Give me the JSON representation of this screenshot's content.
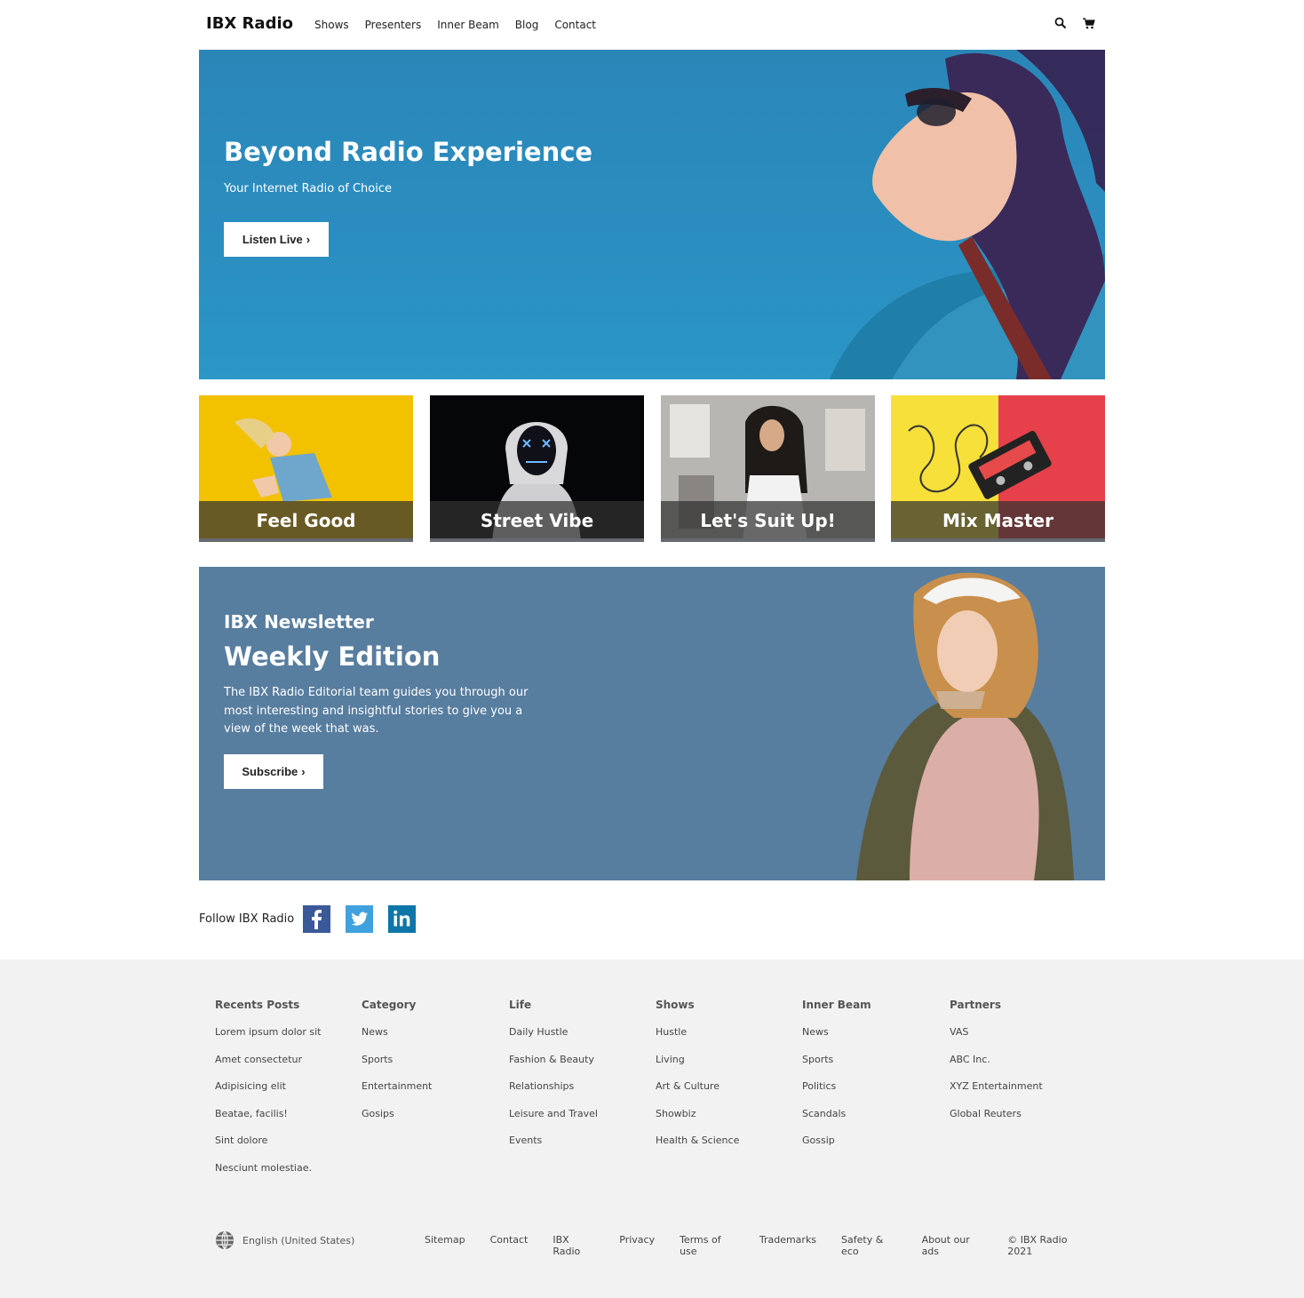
{
  "header": {
    "brand": "IBX Radio",
    "nav": [
      "Shows",
      "Presenters",
      "Inner Beam",
      "Blog",
      "Contact"
    ],
    "icons": [
      "search-icon",
      "cart-icon"
    ]
  },
  "hero": {
    "title": "Beyond Radio Experience",
    "subtitle": "Your Internet Radio of Choice",
    "button": "Listen Live",
    "bg_color": "#2b8ec0"
  },
  "tiles": [
    {
      "label": "Feel Good",
      "bg": "#f2c200"
    },
    {
      "label": "Street Vibe",
      "bg": "#0a0a0a"
    },
    {
      "label": "Let's Suit Up!",
      "bg": "#c9c9c9"
    },
    {
      "label": "Mix Master",
      "bg": "#f7e03a"
    }
  ],
  "newsletter": {
    "kicker": "IBX Newsletter",
    "title": "Weekly Edition",
    "body": "The IBX Radio Editorial team guides you through our most interesting and insightful stories to give you a view of the week that was.",
    "button": "Subscribe",
    "bg_color": "#577d9f"
  },
  "social": {
    "label": "Follow IBX Radio",
    "networks": [
      "facebook-icon",
      "twitter-icon",
      "linkedin-icon"
    ]
  },
  "footer": {
    "columns": [
      {
        "title": "Recents Posts",
        "links": [
          "Lorem ipsum dolor sit",
          "Amet consectetur",
          "Adipisicing elit",
          "Beatae, facilis!",
          "Sint dolore",
          "Nesciunt molestiae."
        ]
      },
      {
        "title": "Category",
        "links": [
          "News",
          "Sports",
          "Entertainment",
          "Gosips"
        ]
      },
      {
        "title": "Life",
        "links": [
          "Daily Hustle",
          "Fashion & Beauty",
          "Relationships",
          "Leisure and Travel",
          "Events"
        ]
      },
      {
        "title": "Shows",
        "links": [
          "Hustle",
          "Living",
          "Art & Culture",
          "Showbiz",
          "Health & Science"
        ]
      },
      {
        "title": "Inner Beam",
        "links": [
          "News",
          "Sports",
          "Politics",
          "Scandals",
          "Gossip"
        ]
      },
      {
        "title": "Partners",
        "links": [
          "VAS",
          "ABC Inc.",
          "XYZ Entertainment",
          "Global Reuters"
        ]
      }
    ],
    "language": "English (United States)",
    "bottom_links": [
      "Sitemap",
      "Contact",
      "IBX Radio",
      "Privacy",
      "Terms of use",
      "Trademarks",
      "Safety & eco",
      "About our ads"
    ],
    "copyright": "© IBX Radio 2021"
  }
}
